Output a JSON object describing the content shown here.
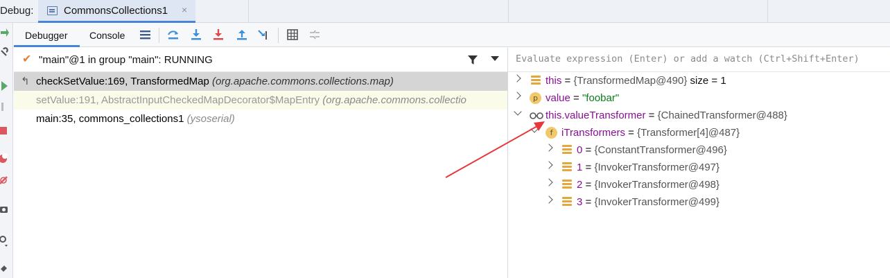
{
  "debug_bar": {
    "label": "Debug:",
    "tab_title": "CommonsCollections1",
    "tab_close": "×"
  },
  "toolbar": {
    "tabs": [
      {
        "label": "Debugger",
        "active": true
      },
      {
        "label": "Console",
        "active": false
      }
    ],
    "icons": [
      "menu-icon",
      "show-execution-point-icon",
      "step-over-icon",
      "step-into-icon",
      "force-step-into-icon",
      "step-out-icon",
      "run-to-cursor-icon",
      "evaluate-expression-icon",
      "trace-icon"
    ]
  },
  "threads": {
    "status_check": "✔",
    "selected_thread": "\"main\"@1 in group \"main\": RUNNING"
  },
  "frames": [
    {
      "method": "checkSetValue:169, TransformedMap",
      "package": "(org.apache.commons.collections.map)",
      "state": "selected"
    },
    {
      "method": "setValue:191, AbstractInputCheckedMapDecorator$MapEntry",
      "package": "(org.apache.commons.collectio",
      "state": "library"
    },
    {
      "method": "main:35, commons_collections1",
      "package": "(ysoserial)",
      "state": "normal"
    }
  ],
  "watch": {
    "placeholder": "Evaluate expression (Enter) or add a watch (Ctrl+Shift+Enter)"
  },
  "variables": [
    {
      "name": "this",
      "eq": " = ",
      "value": "{TransformedMap@490}",
      "extra": "  size = 1",
      "icon": "field-icon",
      "expanded": false,
      "level": 0
    },
    {
      "name": "value",
      "eq": " = ",
      "value": "\"foobar\"",
      "extra": "",
      "icon": "parameter-icon",
      "icon_letter": "p",
      "expanded": false,
      "level": 0
    },
    {
      "name": "this.valueTransformer",
      "eq": " = ",
      "value": "{ChainedTransformer@488}",
      "extra": "",
      "icon": "watch-glasses-icon",
      "expanded": true,
      "level": 0
    },
    {
      "name": "iTransformers",
      "eq": " = ",
      "value": "{Transformer[4]@487}",
      "extra": "",
      "icon": "final-field-icon",
      "icon_letter": "f",
      "expanded": true,
      "level": 1
    },
    {
      "name": "0",
      "eq": " = ",
      "value": "{ConstantTransformer@496}",
      "extra": "",
      "icon": "field-icon",
      "expanded": false,
      "level": 2
    },
    {
      "name": "1",
      "eq": " = ",
      "value": "{InvokerTransformer@497}",
      "extra": "",
      "icon": "field-icon",
      "expanded": false,
      "level": 2
    },
    {
      "name": "2",
      "eq": " = ",
      "value": "{InvokerTransformer@498}",
      "extra": "",
      "icon": "field-icon",
      "expanded": false,
      "level": 2
    },
    {
      "name": "3",
      "eq": " = ",
      "value": "{InvokerTransformer@499}",
      "extra": "",
      "icon": "field-icon",
      "expanded": false,
      "level": 2
    }
  ],
  "colors": {
    "accent": "#4a84d8",
    "annotation_arrow": "#e8373a",
    "field_name": "#871094",
    "string_value": "#067d17"
  }
}
